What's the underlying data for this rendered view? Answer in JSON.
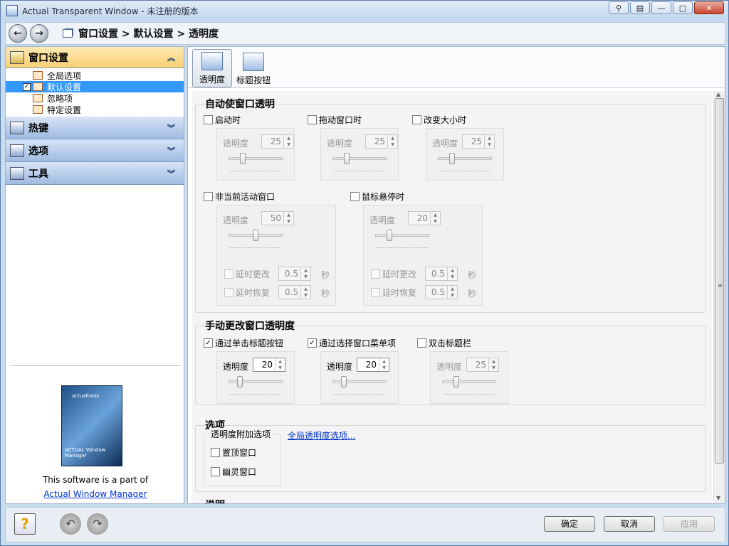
{
  "window": {
    "title": "Actual Transparent Window - 未注册的版本"
  },
  "nav": {
    "breadcrumb": "窗口设置 > 默认设置 > 透明度"
  },
  "sidebar": {
    "sections": [
      {
        "label": "窗口设置"
      },
      {
        "label": "热键"
      },
      {
        "label": "选项"
      },
      {
        "label": "工具"
      }
    ],
    "tree_items": [
      {
        "label": "全局选项"
      },
      {
        "label": "默认设置",
        "checked": true,
        "selected": true
      },
      {
        "label": "忽略项"
      },
      {
        "label": "特定设置"
      }
    ],
    "promo": {
      "box_brand": "actualtools",
      "box_title": "ACTUAL Window Manager",
      "text": "This software is a part of",
      "link": "Actual Window Manager"
    }
  },
  "tabs": [
    {
      "label": "透明度"
    },
    {
      "label": "标题按钮"
    }
  ],
  "auto": {
    "title": "自动使窗口透明",
    "startup": {
      "label": "启动时",
      "checked": false,
      "opacity_label": "透明度",
      "value": "25",
      "level": 0.25
    },
    "drag": {
      "label": "拖动窗口时",
      "checked": false,
      "opacity_label": "透明度",
      "value": "25",
      "level": 0.25
    },
    "resize": {
      "label": "改变大小时",
      "checked": false,
      "opacity_label": "透明度",
      "value": "25",
      "level": 0.25
    },
    "inactive": {
      "label": "非当前活动窗口",
      "checked": false,
      "opacity_label": "透明度",
      "value": "50",
      "level": 0.5,
      "delay_change": {
        "label": "延时更改",
        "value": "0.5",
        "unit": "秒"
      },
      "delay_restore": {
        "label": "延时恢复",
        "value": "0.5",
        "unit": "秒"
      }
    },
    "hover": {
      "label": "鼠标悬停时",
      "checked": false,
      "opacity_label": "透明度",
      "value": "20",
      "level": 0.2,
      "delay_change": {
        "label": "延时更改",
        "value": "0.5",
        "unit": "秒"
      },
      "delay_restore": {
        "label": "延时恢复",
        "value": "0.5",
        "unit": "秒"
      }
    }
  },
  "manual": {
    "title": "手动更改窗口透明度",
    "title_button": {
      "label": "通过单击标题按钮",
      "checked": true,
      "opacity_label": "透明度",
      "value": "20",
      "level": 0.2
    },
    "menu_item": {
      "label": "通过选择窗口菜单项",
      "checked": true,
      "opacity_label": "透明度",
      "value": "20",
      "level": 0.2
    },
    "dblclick": {
      "label": "双击标题栏",
      "checked": false,
      "opacity_label": "透明度",
      "value": "25",
      "level": 0.25
    }
  },
  "options": {
    "title": "选项",
    "fieldset": "透明度附加选项",
    "topmost": "置顶窗口",
    "ghost": "幽灵窗口",
    "global_link": "全局透明度选项..."
  },
  "desc_title": "说明",
  "buttons": {
    "ok": "确定",
    "cancel": "取消",
    "apply": "应用"
  }
}
